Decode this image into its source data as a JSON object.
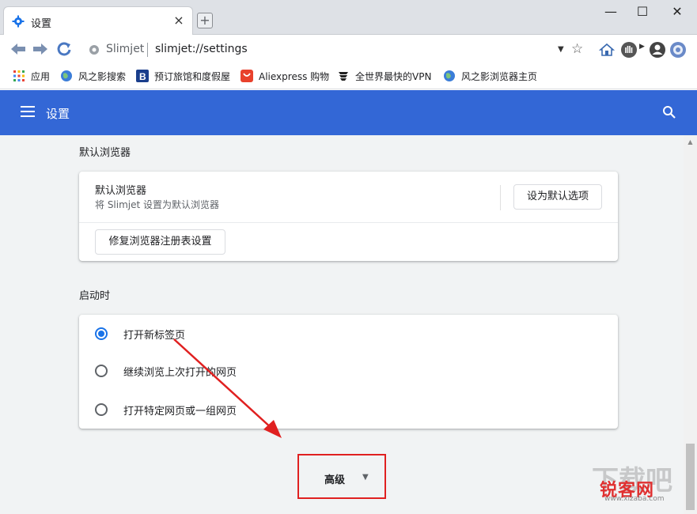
{
  "window": {
    "tab_title": "设置",
    "tab_close": "×",
    "new_tab": "+",
    "minimize": "—",
    "maximize": "☐",
    "close": "✕"
  },
  "address_bar": {
    "site_name": "Slimjet",
    "url": "slimjet://settings"
  },
  "bookmarks": [
    {
      "label": "应用",
      "icon": "apps-grid-icon"
    },
    {
      "label": "风之影搜索",
      "icon": "globe-icon"
    },
    {
      "label": "预订旅馆和度假屋",
      "icon": "booking-icon"
    },
    {
      "label": "Aliexpress 购物",
      "icon": "aliexpress-icon"
    },
    {
      "label": "全世界最快的VPN",
      "icon": "vpn-icon"
    },
    {
      "label": "风之影浏览器主页",
      "icon": "globe-icon"
    }
  ],
  "header": {
    "title": "设置"
  },
  "default_browser": {
    "section_title": "默认浏览器",
    "row_title": "默认浏览器",
    "row_subtitle": "将 Slimjet 设置为默认浏览器",
    "set_default_button": "设为默认选项",
    "repair_button": "修复浏览器注册表设置"
  },
  "on_startup": {
    "section_title": "启动时",
    "options": [
      {
        "label": "打开新标签页",
        "checked": true
      },
      {
        "label": "继续浏览上次打开的网页",
        "checked": false
      },
      {
        "label": "打开特定网页或一组网页",
        "checked": false
      }
    ]
  },
  "advanced": {
    "label": "高级"
  },
  "watermark": {
    "main": "锐客网",
    "sub": "www.xizaba.com",
    "bg": "下载吧"
  },
  "colors": {
    "header_blue": "#3367d6",
    "radio_blue": "#1a73e8",
    "highlight_red": "#e02020"
  }
}
